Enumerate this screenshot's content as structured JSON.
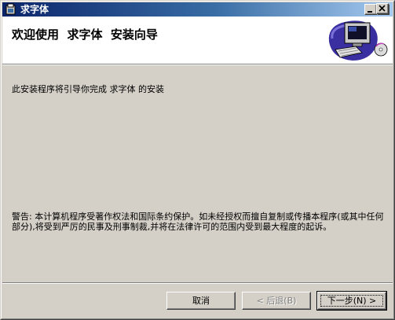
{
  "window": {
    "title": "求字体",
    "controls": [
      "minimize-icon",
      "maximize-icon",
      "close-icon"
    ]
  },
  "header": {
    "title": "欢迎使用  求字体  安装向导",
    "graphic": "computer-setup-icon"
  },
  "content": {
    "intro": "此安装程序将引导你完成 求字体 的安装",
    "warning": "警告: 本计算机程序受著作权法和国际条约保护。如未经授权而擅自复制或传播本程序(或其中任何部分),将受到严厉的民事及刑事制裁,并将在法律许可的范围内受到最大程度的起诉。"
  },
  "buttons": {
    "cancel": "取消",
    "back": "< 后退(B)",
    "next": "下一步(N) >"
  },
  "colors": {
    "titlebar_start": "#0a246a",
    "titlebar_end": "#a6caf0",
    "face": "#d4d0c8"
  }
}
